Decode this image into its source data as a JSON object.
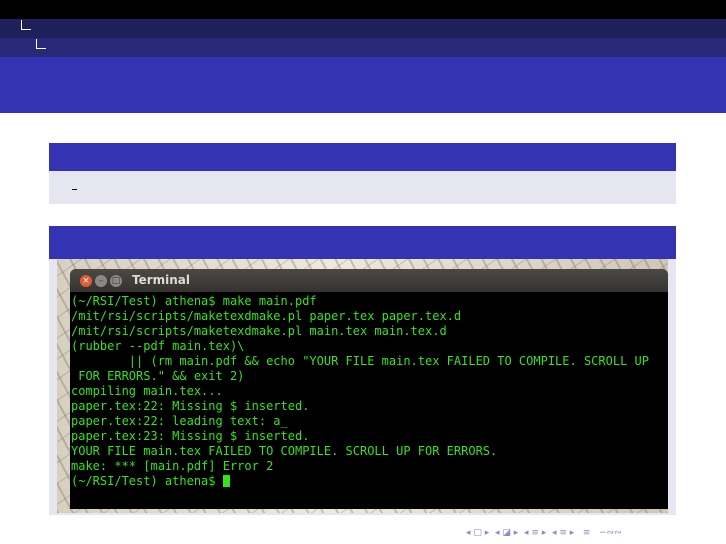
{
  "terminal": {
    "window_title": "Terminal",
    "buttons": {
      "close_glyph": "×",
      "minimize_glyph": "–",
      "maximize_glyph": "□"
    },
    "lines": [
      "(~/RSI/Test) athena$ make main.pdf",
      "/mit/rsi/scripts/maketexdmake.pl paper.tex paper.tex.d",
      "/mit/rsi/scripts/maketexdmake.pl main.tex main.tex.d",
      "(rubber --pdf main.tex)\\",
      "        || (rm main.pdf && echo \"YOUR FILE main.tex FAILED TO COMPILE. SCROLL UP",
      " FOR ERRORS.\" && exit 2)",
      "compiling main.tex...",
      "paper.tex:22: Missing $ inserted.",
      "paper.tex:22: leading text: a_",
      "paper.tex:23: Missing $ inserted.",
      "YOUR FILE main.tex FAILED TO COMPILE. SCROLL UP FOR ERRORS.",
      "make: *** [main.pdf] Error 2",
      "(~/RSI/Test) athena$ "
    ]
  },
  "slide_nav": {
    "symbols": "◂ ▢ ▸  ◂ ◪ ▸  ◂ ≡ ▸  ◂ ≡ ▸   ≡   ∽∾∾"
  },
  "colors": {
    "terminal_text": "#35e41a",
    "theme_blue": "#3333b3"
  }
}
